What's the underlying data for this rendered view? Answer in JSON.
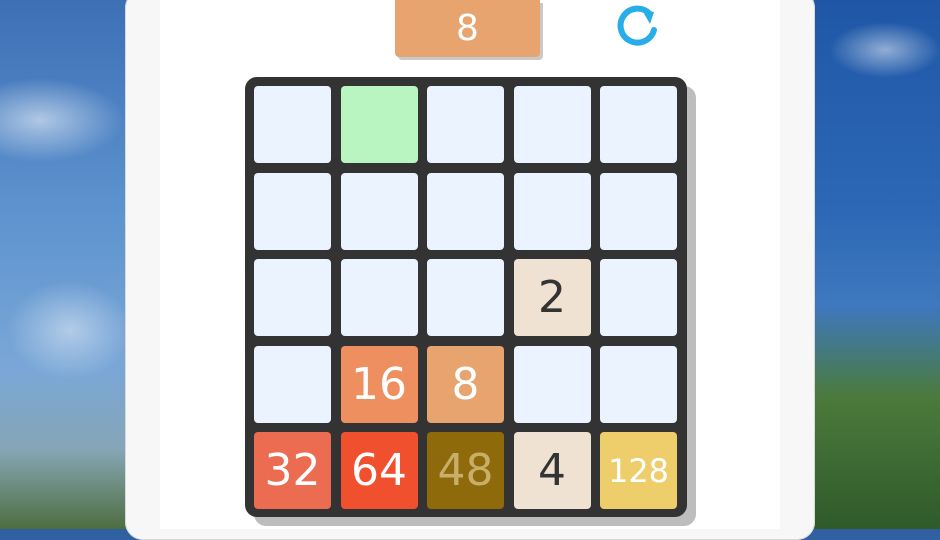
{
  "current_tile": {
    "value": "8",
    "color": "#e8a46f"
  },
  "refresh_icon": {
    "name": "refresh-icon",
    "color": "#27aee8"
  },
  "board": {
    "rows": 5,
    "cols": 5,
    "empty_color": "#eaf3ff",
    "highlight_color": "#b8f5c0",
    "cells": [
      [
        {
          "value": "",
          "bg": "#eaf3ff"
        },
        {
          "value": "",
          "bg": "#b8f5c0"
        },
        {
          "value": "",
          "bg": "#eaf3ff"
        },
        {
          "value": "",
          "bg": "#eaf3ff"
        },
        {
          "value": "",
          "bg": "#eaf3ff"
        }
      ],
      [
        {
          "value": "",
          "bg": "#eaf3ff"
        },
        {
          "value": "",
          "bg": "#eaf3ff"
        },
        {
          "value": "",
          "bg": "#eaf3ff"
        },
        {
          "value": "",
          "bg": "#eaf3ff"
        },
        {
          "value": "",
          "bg": "#eaf3ff"
        }
      ],
      [
        {
          "value": "",
          "bg": "#eaf3ff"
        },
        {
          "value": "",
          "bg": "#eaf3ff"
        },
        {
          "value": "",
          "bg": "#eaf3ff"
        },
        {
          "value": "2",
          "bg": "#efe2d2",
          "fg": "#333333"
        },
        {
          "value": "",
          "bg": "#eaf3ff"
        }
      ],
      [
        {
          "value": "",
          "bg": "#eaf3ff"
        },
        {
          "value": "16",
          "bg": "#ee8f60",
          "fg": "#ffffff"
        },
        {
          "value": "8",
          "bg": "#e8a46f",
          "fg": "#ffffff"
        },
        {
          "value": "",
          "bg": "#eaf3ff"
        },
        {
          "value": "",
          "bg": "#eaf3ff"
        }
      ],
      [
        {
          "value": "32",
          "bg": "#ec6c52",
          "fg": "#ffffff"
        },
        {
          "value": "64",
          "bg": "#f0502d",
          "fg": "#ffffff"
        },
        {
          "value": "48",
          "bg": "#8f6a0a",
          "fg": "#c9ae6a"
        },
        {
          "value": "4",
          "bg": "#efe2d2",
          "fg": "#333333"
        },
        {
          "value": "128",
          "bg": "#eecd6b",
          "fg": "#ffffff",
          "small": true
        }
      ]
    ]
  }
}
